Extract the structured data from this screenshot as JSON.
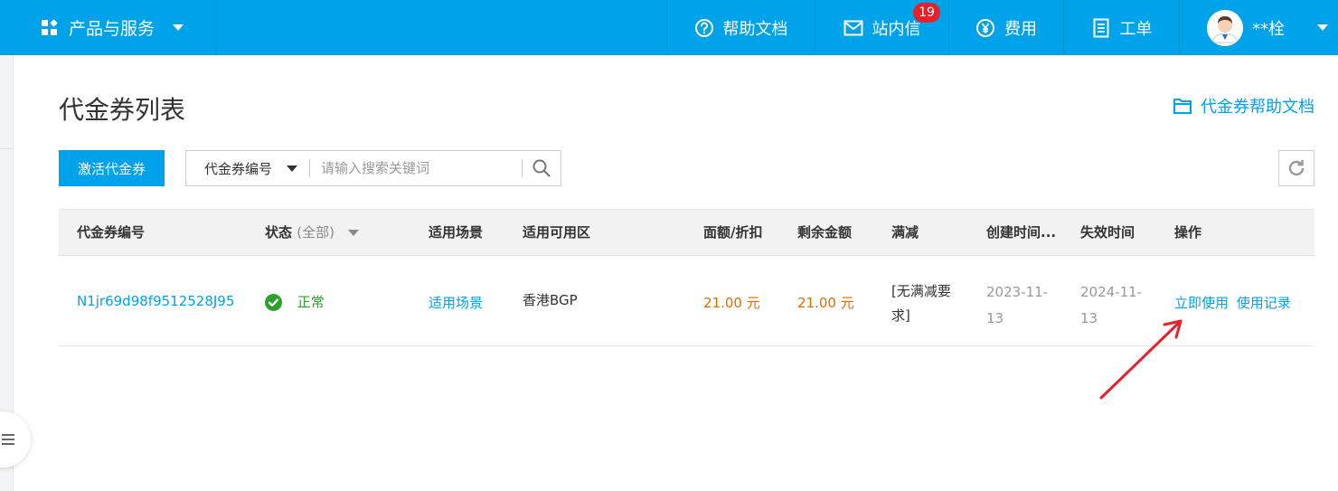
{
  "topbar": {
    "products_label": "产品与服务",
    "help_label": "帮助文档",
    "messages_label": "站内信",
    "messages_badge": "19",
    "billing_label": "费用",
    "ticket_label": "工单",
    "user_name": "**栓"
  },
  "page": {
    "title": "代金券列表",
    "help_link": "代金券帮助文档"
  },
  "toolbar": {
    "activate_label": "激活代金券",
    "search_field_select": "代金券编号",
    "search_placeholder": "请输入搜索关键词"
  },
  "table": {
    "headers": {
      "code": "代金券编号",
      "status": "状态",
      "status_filter": "(全部)",
      "scene": "适用场景",
      "region": "适用可用区",
      "face_value": "面额/折扣",
      "remaining": "剩余金额",
      "discount_rule": "满减",
      "created": "创建时间...",
      "expires": "失效时间",
      "action": "操作"
    },
    "rows": [
      {
        "code": "N1jr69d98f9512528J95",
        "status": "正常",
        "scene": "适用场景",
        "region": "香港BGP",
        "face_value": "21.00 元",
        "remaining": "21.00 元",
        "discount_rule_line1": "[无满减要",
        "discount_rule_line2": "求]",
        "created_line1": "2023-11-",
        "created_line2": "13",
        "expires_line1": "2024-11-",
        "expires_line2": "13",
        "action_use": "立即使用",
        "action_history": "使用记录"
      }
    ]
  },
  "colors": {
    "brand": "#00a2ea",
    "badge": "#e8202a",
    "amount": "#e06c00",
    "status_ok": "#2fa02e",
    "annotation_arrow": "#e8202a"
  },
  "icons": {
    "products": "grid-icon",
    "help": "question-circle-icon",
    "messages": "envelope-icon",
    "billing": "yen-circle-icon",
    "ticket": "document-icon",
    "help_link": "folder-icon",
    "search": "search-icon",
    "refresh": "refresh-icon",
    "status": "check-circle-icon"
  }
}
